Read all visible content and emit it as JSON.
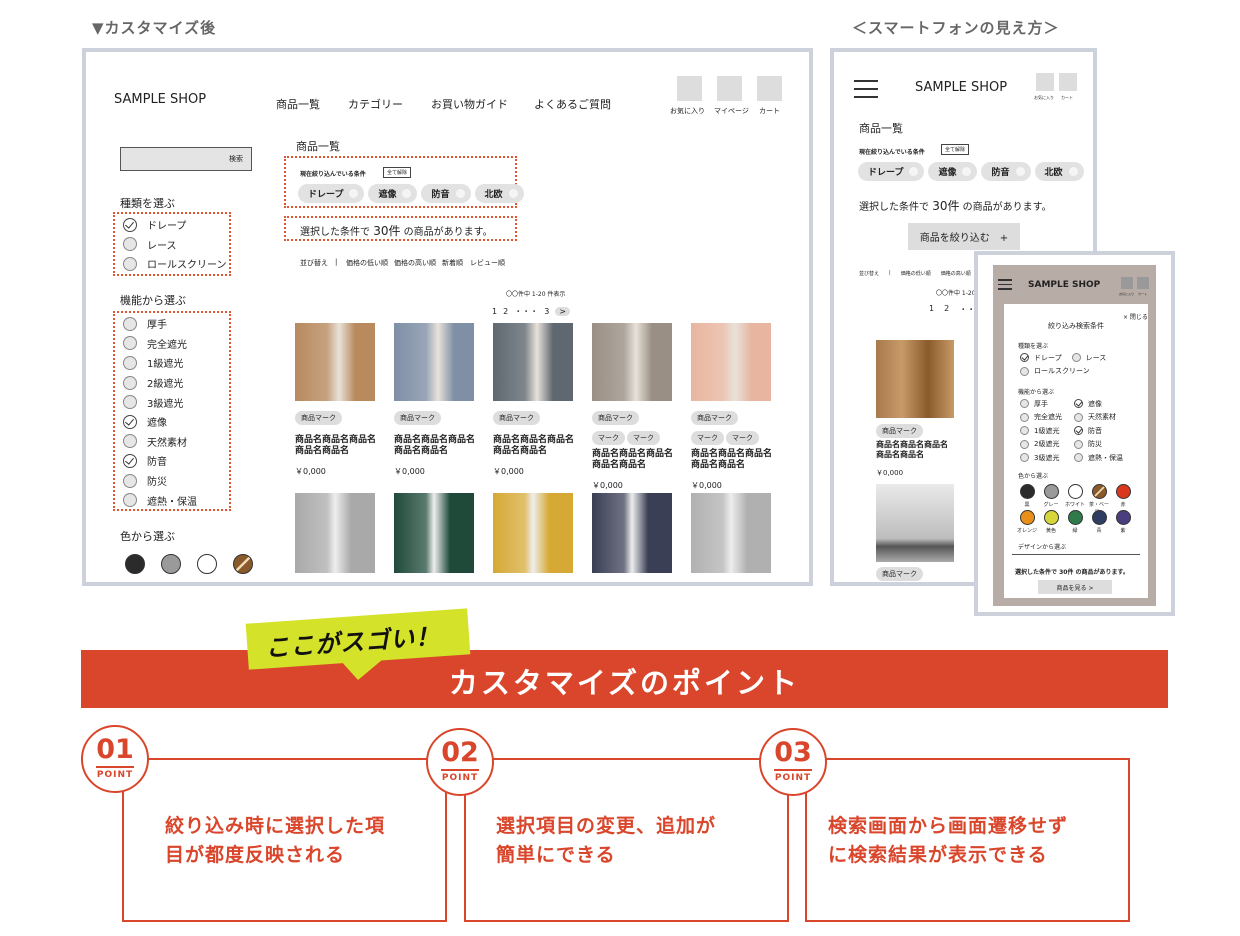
{
  "labels": {
    "after": "▼カスタマイズ後",
    "smartphone": "＜スマートフォンの見え方＞"
  },
  "pc": {
    "logo": "SAMPLE SHOP",
    "nav": [
      "商品一覧",
      "カテゴリー",
      "お買い物ガイド",
      "よくあるご質問"
    ],
    "header_icons": [
      "お気に入り",
      "マイページ",
      "カート"
    ],
    "search_button": "検索",
    "type_heading": "種類を選ぶ",
    "types": [
      {
        "label": "ドレープ",
        "checked": true
      },
      {
        "label": "レース",
        "checked": false
      },
      {
        "label": "ロールスクリーン",
        "checked": false
      }
    ],
    "function_heading": "機能から選ぶ",
    "functions": [
      {
        "label": "厚手",
        "checked": false
      },
      {
        "label": "完全遮光",
        "checked": false
      },
      {
        "label": "1級遮光",
        "checked": false
      },
      {
        "label": "2級遮光",
        "checked": false
      },
      {
        "label": "3級遮光",
        "checked": false
      },
      {
        "label": "遮像",
        "checked": true
      },
      {
        "label": "天然素材",
        "checked": false
      },
      {
        "label": "防音",
        "checked": true
      },
      {
        "label": "防災",
        "checked": false
      },
      {
        "label": "遮熱・保温",
        "checked": false
      }
    ],
    "color_heading": "色から選ぶ",
    "colors": [
      "#2b2b2b",
      "#9a9a9a",
      "#ffffff",
      "#8a5a2b"
    ],
    "page_title": "商品一覧",
    "conditions_label": "現在絞り込んでいる条件",
    "clear_all": "全て解除",
    "chips": [
      "ドレープ",
      "遮像",
      "防音",
      "北欧"
    ],
    "result_prefix": "選択した条件で",
    "result_count": "30件",
    "result_suffix": "の商品があります。",
    "sort": [
      "並び替え",
      "|",
      "価格の低い順",
      "価格の高い順",
      "新着順",
      "レビュー順"
    ],
    "count_text": "〇〇件中 1-20 件表示",
    "pagination": [
      "1",
      "2",
      "・・・",
      "3",
      ">"
    ],
    "products": [
      {
        "marks": [
          "商品マーク"
        ],
        "name": "商品名商品名商品名\n商品名商品名",
        "price": "￥0,000",
        "color": "#b88a5e"
      },
      {
        "marks": [
          "商品マーク"
        ],
        "name": "商品名商品名商品名\n商品名商品名",
        "price": "￥0,000",
        "color": "#7f8fa6"
      },
      {
        "marks": [
          "商品マーク"
        ],
        "name": "商品名商品名商品名\n商品名商品名",
        "price": "￥0,000",
        "color": "#5f6870"
      },
      {
        "marks": [
          "商品マーク",
          "マーク",
          "マーク"
        ],
        "name": "商品名商品名商品名\n商品名商品名",
        "price": "￥0,000",
        "color": "#9a8f84"
      },
      {
        "marks": [
          "商品マーク",
          "マーク",
          "マーク"
        ],
        "name": "商品名商品名商品名\n商品名商品名",
        "price": "￥0,000",
        "color": "#e8b6a0"
      }
    ],
    "row2_colors": [
      "#a9a9a9",
      "#1f4a3a",
      "#d6a935",
      "#3a3f55",
      "#b0b0b0"
    ]
  },
  "sp": {
    "logo": "SAMPLE SHOP",
    "header_icons": [
      "お気に入り",
      "カート"
    ],
    "page_title": "商品一覧",
    "conditions_label": "現在絞り込んでいる条件",
    "clear_all": "全て解除",
    "chips": [
      "ドレープ",
      "遮像",
      "防音",
      "北欧"
    ],
    "result_prefix": "選択した条件で",
    "result_count": "30件",
    "result_suffix": "の商品があります。",
    "filter_button": "商品を絞り込む　+",
    "sort": [
      "並び替え",
      "|",
      "価格の低い順",
      "価格の高い順"
    ],
    "count_text": "〇〇件中 1-20 件表示",
    "pagination": [
      "1",
      "2",
      "・・・"
    ],
    "product_mark": "商品マーク",
    "product_name": "商品名商品名商品名\n商品名商品名",
    "product_price": "￥0,000",
    "product_mark2": "商品マーク"
  },
  "modal": {
    "logo": "SAMPLE SHOP",
    "header_icons": [
      "お気に入り",
      "カート"
    ],
    "close": "× 閉じる",
    "title": "絞り込み検索条件",
    "type_heading": "種類を選ぶ",
    "types": [
      {
        "label": "ドレープ",
        "checked": true
      },
      {
        "label": "レース",
        "checked": false
      },
      {
        "label": "ロールスクリーン",
        "checked": false
      }
    ],
    "function_heading": "機能から選ぶ",
    "functions_left": [
      {
        "label": "厚手",
        "checked": false
      },
      {
        "label": "完全遮光",
        "checked": false
      },
      {
        "label": "1級遮光",
        "checked": false
      },
      {
        "label": "2級遮光",
        "checked": false
      },
      {
        "label": "3級遮光",
        "checked": false
      }
    ],
    "functions_right": [
      {
        "label": "遮像",
        "checked": true
      },
      {
        "label": "天然素材",
        "checked": false
      },
      {
        "label": "防音",
        "checked": true
      },
      {
        "label": "防災",
        "checked": false
      },
      {
        "label": "遮熱・保温",
        "checked": false
      }
    ],
    "color_heading": "色から選ぶ",
    "colors_row1": [
      {
        "label": "黒",
        "color": "#2b2b2b"
      },
      {
        "label": "グレー",
        "color": "#9a9a9a"
      },
      {
        "label": "ホワイト",
        "color": "#ffffff"
      },
      {
        "label": "茶・ベージュ",
        "color": "#8a5a2b"
      },
      {
        "label": "赤",
        "color": "#d9381e"
      }
    ],
    "colors_row2": [
      {
        "label": "オレンジ",
        "color": "#e8901a"
      },
      {
        "label": "黄色",
        "color": "#d6d63a"
      },
      {
        "label": "緑",
        "color": "#2e7a4a"
      },
      {
        "label": "青",
        "color": "#2f3d60"
      },
      {
        "label": "紫",
        "color": "#4a3e7e"
      }
    ],
    "design_heading": "デザインから選ぶ",
    "result_text": "選択した条件で 30件 の商品があります。",
    "see_button": "商品を見る >"
  },
  "banner": {
    "badge": "ここがスゴい！",
    "title": "カスタマイズのポイント",
    "accent": "#d9462b",
    "badge_color": "#d4e22a"
  },
  "points": [
    {
      "num": "01",
      "label": "POINT",
      "text_line1": "絞り込み時に選択した項",
      "text_line2": "目が都度反映される"
    },
    {
      "num": "02",
      "label": "POINT",
      "text_line1": "選択項目の変更、追加が",
      "text_line2": "簡単にできる"
    },
    {
      "num": "03",
      "label": "POINT",
      "text_line1": "検索画面から画面遷移せず",
      "text_line2": "に検索結果が表示できる"
    }
  ]
}
